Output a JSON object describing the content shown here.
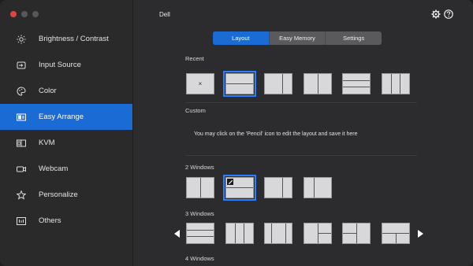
{
  "app": {
    "title": "Dell"
  },
  "sidebar": {
    "items": [
      {
        "label": "Brightness / Contrast",
        "icon": "sun-icon"
      },
      {
        "label": "Input Source",
        "icon": "input-source-icon"
      },
      {
        "label": "Color",
        "icon": "palette-icon"
      },
      {
        "label": "Easy Arrange",
        "icon": "easy-arrange-icon",
        "active": true
      },
      {
        "label": "KVM",
        "icon": "kvm-icon"
      },
      {
        "label": "Webcam",
        "icon": "webcam-icon"
      },
      {
        "label": "Personalize",
        "icon": "star-icon"
      },
      {
        "label": "Others",
        "icon": "others-icon"
      }
    ]
  },
  "tabs": [
    {
      "label": "Layout",
      "active": true
    },
    {
      "label": "Easy Memory"
    },
    {
      "label": "Settings"
    }
  ],
  "sections": {
    "recent": "Recent",
    "custom": "Custom",
    "custom_hint": "You may click on the 'Pencil' icon to edit the layout and save it here",
    "two_windows": "2 Windows",
    "three_windows": "3 Windows",
    "four_windows": "4 Windows"
  },
  "recent_close_glyph": "×",
  "colors": {
    "accent": "#1b6bd4",
    "selected_outline": "#2a7fff"
  }
}
